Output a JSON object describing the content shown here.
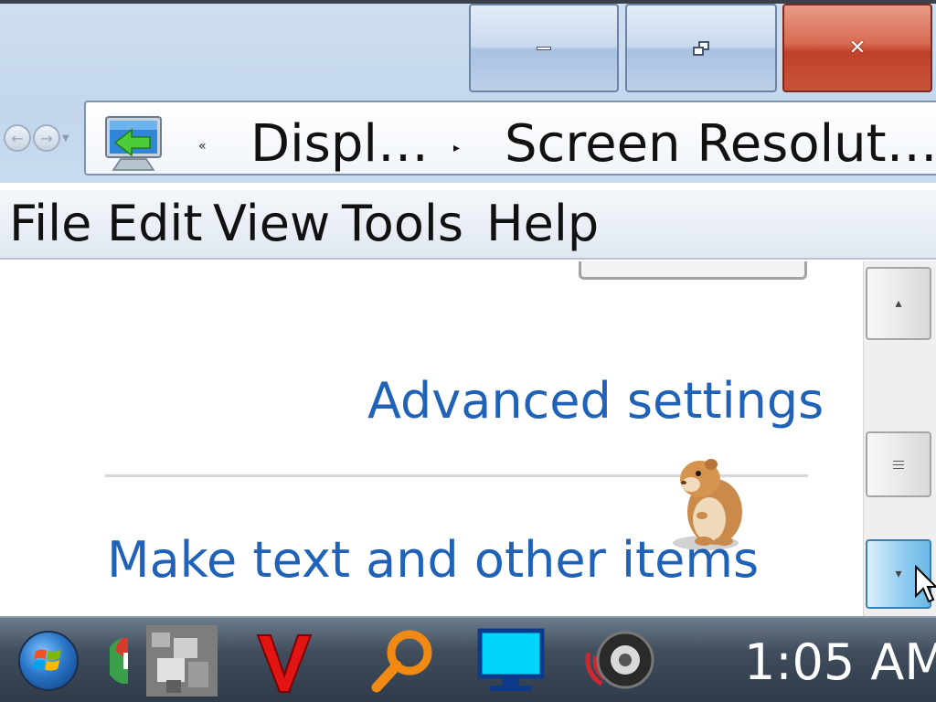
{
  "window": {
    "minimize_label": "—",
    "maximize_label": "❐",
    "close_label": "✕"
  },
  "navigation": {
    "back_icon": "back-arrow-icon",
    "forward_icon": "forward-arrow-icon",
    "recent_pages_icon": "chevron-down-icon"
  },
  "address_bar": {
    "icon": "display-settings-icon",
    "overflow_chevron": "«",
    "breadcrumbs": [
      "Displ…",
      "Screen Resolut…"
    ],
    "separator": "▸"
  },
  "menu": {
    "items": [
      "File",
      "Edit",
      "View",
      "Tools",
      "Help"
    ]
  },
  "content": {
    "advanced_settings_link": "Advanced settings",
    "make_text_link": "Make text and other items"
  },
  "scrollbar": {
    "up_icon": "arrow-up-icon",
    "thumb_icon": "grip-icon",
    "down_icon": "arrow-down-icon"
  },
  "taskbar": {
    "start_icon": "windows-start-orb-icon",
    "pinned_icons": [
      "chrome-icon",
      "hamster-photo-icon",
      "red-v-icon",
      "search-magnifier-icon",
      "monitor-icon",
      "speaker-icon"
    ],
    "clock": "1:05 AM"
  },
  "colors": {
    "link": "#1f62b7",
    "close_button": "#c9523b",
    "taskbar": "#3f4d5c",
    "scroll_down_active": "#8fcbef"
  }
}
